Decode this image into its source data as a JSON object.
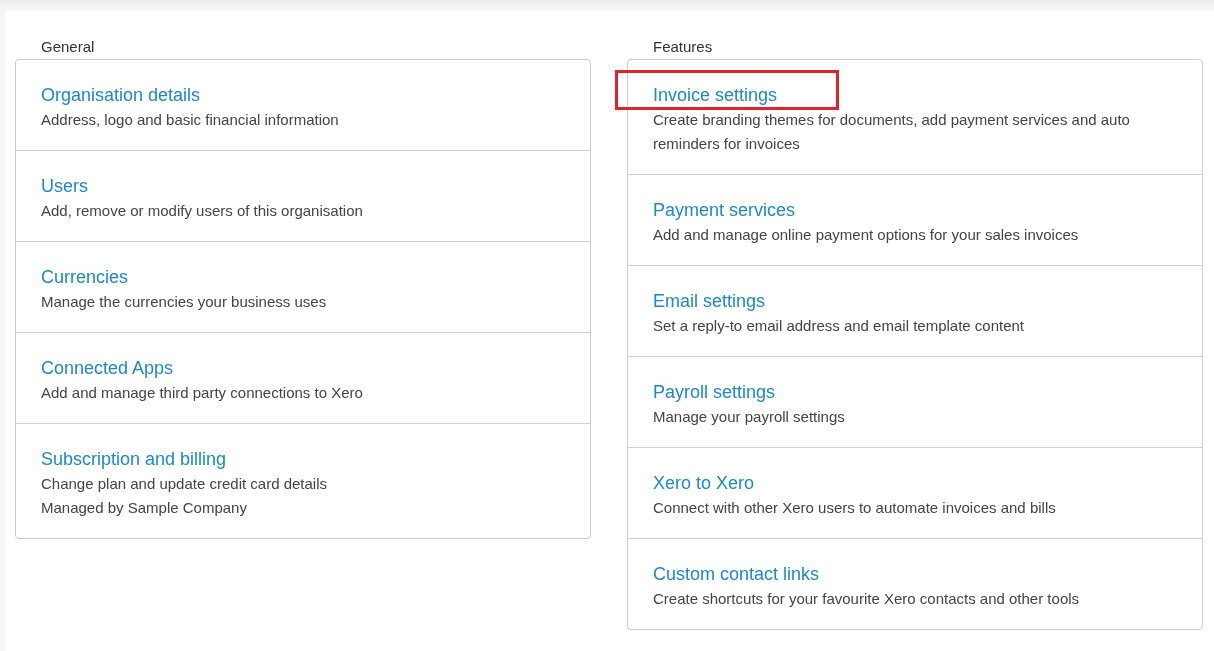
{
  "sections": [
    {
      "heading": "General",
      "items": [
        {
          "title": "Organisation details",
          "lines": [
            "Address, logo and basic financial information"
          ],
          "highlighted": false
        },
        {
          "title": "Users",
          "lines": [
            "Add, remove or modify users of this organisation"
          ],
          "highlighted": false
        },
        {
          "title": "Currencies",
          "lines": [
            "Manage the currencies your business uses"
          ],
          "highlighted": false
        },
        {
          "title": "Connected Apps",
          "lines": [
            "Add and manage third party connections to Xero"
          ],
          "highlighted": false
        },
        {
          "title": "Subscription and billing",
          "lines": [
            "Change plan and update credit card details",
            "Managed by Sample Company"
          ],
          "highlighted": false
        }
      ]
    },
    {
      "heading": "Features",
      "items": [
        {
          "title": "Invoice settings",
          "lines": [
            "Create branding themes for documents, add payment services and auto reminders for invoices"
          ],
          "highlighted": true
        },
        {
          "title": "Payment services",
          "lines": [
            "Add and manage online payment options for your sales invoices"
          ],
          "highlighted": false
        },
        {
          "title": "Email settings",
          "lines": [
            "Set a reply-to email address and email template content"
          ],
          "highlighted": false
        },
        {
          "title": "Payroll settings",
          "lines": [
            "Manage your payroll settings"
          ],
          "highlighted": false
        },
        {
          "title": "Xero to Xero",
          "lines": [
            "Connect with other Xero users to automate invoices and bills"
          ],
          "highlighted": false
        },
        {
          "title": "Custom contact links",
          "lines": [
            "Create shortcuts for your favourite Xero contacts and other tools"
          ],
          "highlighted": false
        }
      ]
    }
  ]
}
